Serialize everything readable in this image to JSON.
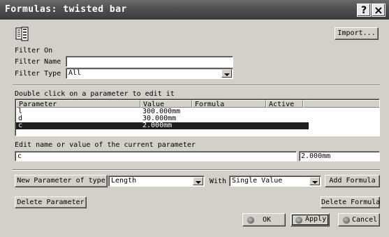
{
  "window": {
    "title": "Formulas: twisted bar"
  },
  "titlebar": {
    "help": "?",
    "close": "×"
  },
  "toolbar": {
    "import_label": "Import..."
  },
  "filter": {
    "heading": "Filter On",
    "name_label": "Filter Name :",
    "name_value": "",
    "type_label": "Filter Type :",
    "type_value": "All"
  },
  "table": {
    "heading": "Double click on a parameter to edit it",
    "columns": [
      "Parameter",
      "Value",
      "Formula",
      "Active"
    ],
    "rows": [
      {
        "parameter": "l",
        "value": "300.000mm",
        "formula": "",
        "active": ""
      },
      {
        "parameter": "d",
        "value": "30.000mm",
        "formula": "",
        "active": ""
      },
      {
        "parameter": "c",
        "value": "2.000mm",
        "formula": "",
        "active": "",
        "selected": true
      }
    ]
  },
  "edit": {
    "heading": "Edit name or value of the current parameter",
    "name_value": "c",
    "value_value": "2.000mm"
  },
  "new_param": {
    "button_label": "New Parameter of type",
    "type_value": "Length",
    "with_label": "With",
    "with_value": "Single Value",
    "add_formula_label": "Add Formula"
  },
  "actions": {
    "delete_param_label": "Delete Parameter",
    "delete_formula_label": "Delete Formula",
    "ok_label": "OK",
    "apply_label": "Apply",
    "cancel_label": "Cancel"
  }
}
